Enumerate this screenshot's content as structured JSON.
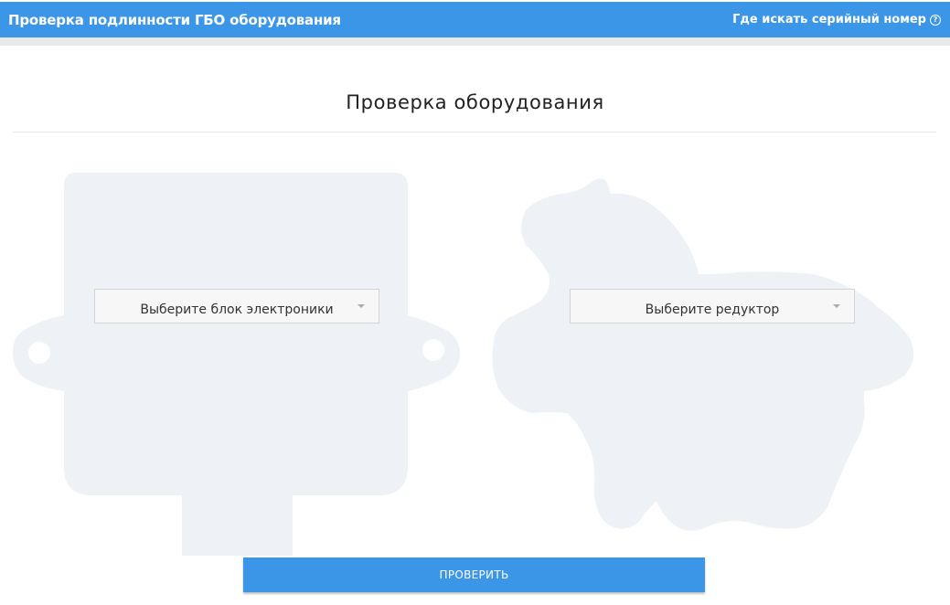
{
  "header": {
    "title": "Проверка подлинности ГБО оборудования",
    "help_link": "Где искать серийный номер",
    "help_icon": "question-circle-icon"
  },
  "main": {
    "title": "Проверка оборудования",
    "ecu_select": {
      "selected": "Выберите блок электроники"
    },
    "reducer_select": {
      "selected": "Выберите редуктор"
    },
    "submit_label": "ПРОВЕРИТЬ"
  },
  "colors": {
    "accent": "#3b96e8",
    "illustration": "#eef1f6"
  }
}
